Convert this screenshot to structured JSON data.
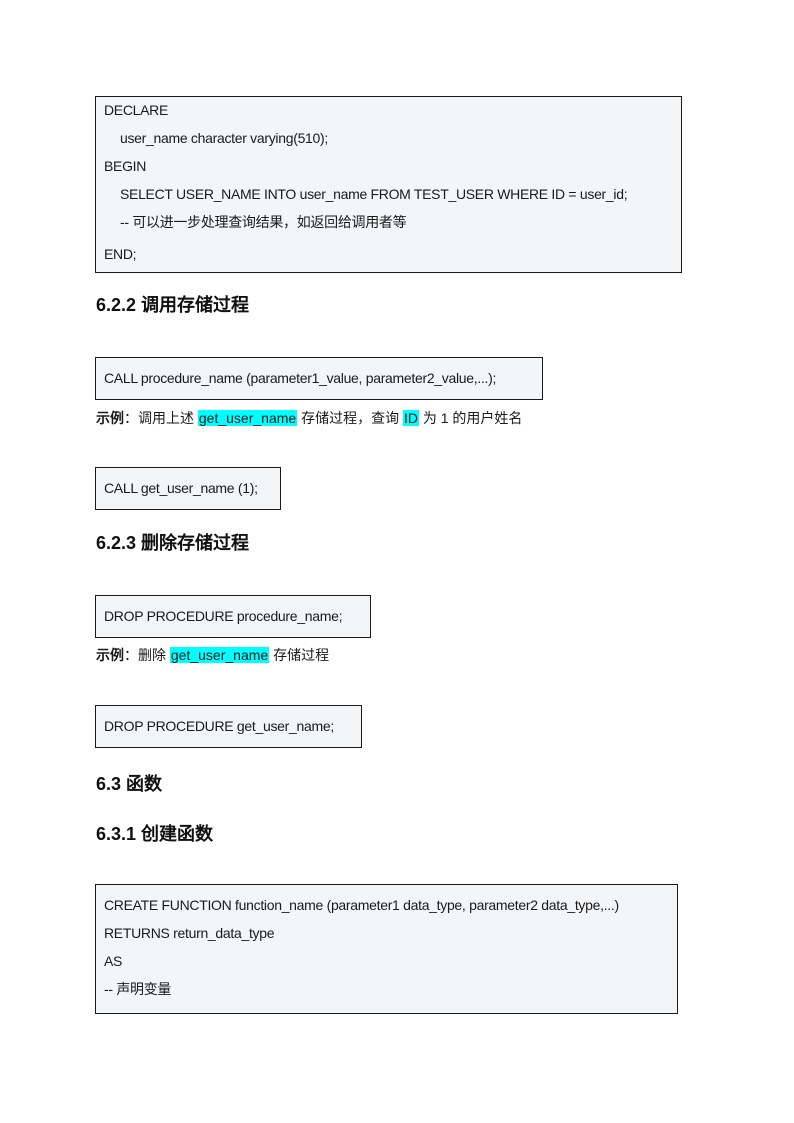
{
  "blocks": {
    "declare": {
      "lines": [
        "DECLARE",
        "user_name character varying(510);",
        "BEGIN",
        "SELECT USER_NAME INTO user_name FROM TEST_USER WHERE ID = user_id;",
        "-- 可以进一步处理查询结果，如返回给调用者等",
        "END;"
      ]
    },
    "call_syntax": "CALL procedure_name (parameter1_value, parameter2_value,...);",
    "call_example": "CALL get_user_name (1);",
    "drop_syntax": "DROP PROCEDURE procedure_name;",
    "drop_example": "DROP PROCEDURE get_user_name;",
    "create_function": {
      "lines": [
        "CREATE FUNCTION function_name (parameter1 data_type, parameter2 data_type,...)",
        "RETURNS return_data_type",
        "AS",
        "-- 声明变量"
      ]
    }
  },
  "headings": {
    "h622": "6.2.2 调用存储过程",
    "h623": "6.2.3 删除存储过程",
    "h63": "6.3 函数",
    "h631": "6.3.1 创建函数"
  },
  "examples": {
    "call": {
      "label": "示例",
      "colon": "：",
      "text1": "调用上述 ",
      "hl1": "get_user_name",
      "text2": " 存储过程，查询 ",
      "hl2": "ID",
      "text3": " 为 1 的用户姓名"
    },
    "drop": {
      "label": "示例",
      "colon": "：",
      "text1": "删除 ",
      "hl1": "get_user_name",
      "text2": " 存储过程"
    }
  },
  "colors": {
    "highlight": "#00ffff",
    "code_bg": "#f4f5f7"
  }
}
